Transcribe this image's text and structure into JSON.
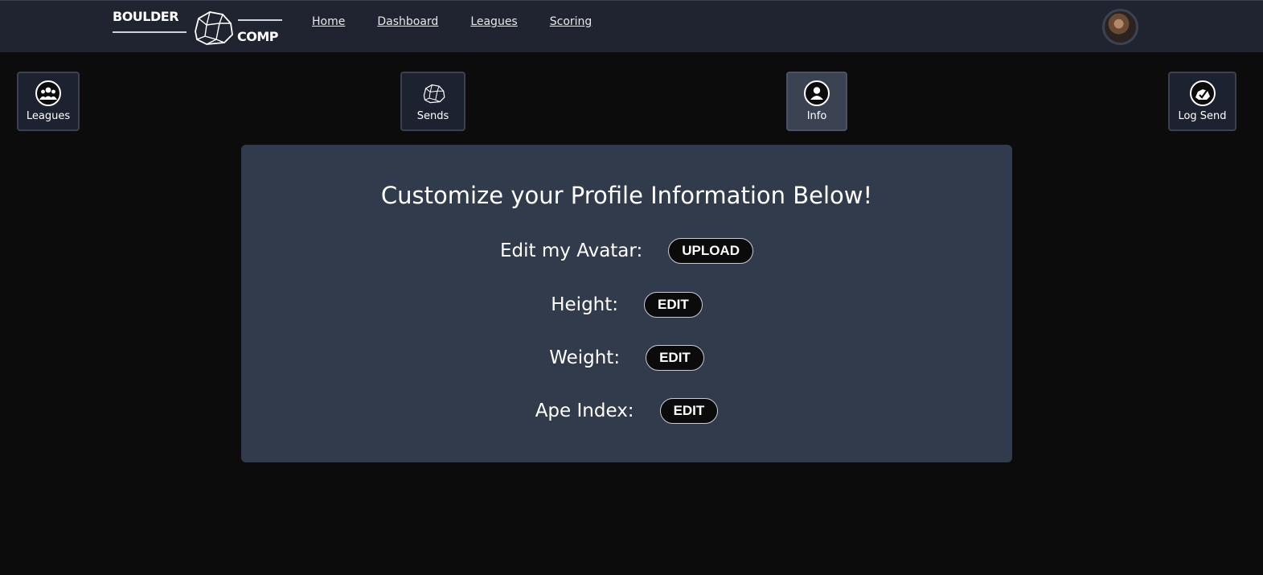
{
  "header": {
    "logo": {
      "top": "BOULDER",
      "bottom": "COMP"
    },
    "nav": [
      {
        "label": "Home"
      },
      {
        "label": "Dashboard"
      },
      {
        "label": "Leagues"
      },
      {
        "label": "Scoring"
      }
    ]
  },
  "tiles": {
    "leagues": {
      "label": "Leagues",
      "icon": "users-icon"
    },
    "sends": {
      "label": "Sends",
      "icon": "boulder-icon"
    },
    "info": {
      "label": "Info",
      "icon": "user-icon"
    },
    "log_send": {
      "label": "Log Send",
      "icon": "log-send-icon"
    }
  },
  "panel": {
    "title": "Customize your Profile Information Below!",
    "rows": [
      {
        "label": "Edit my Avatar:",
        "button": "UPLOAD"
      },
      {
        "label": "Height:",
        "button": "EDIT"
      },
      {
        "label": "Weight:",
        "button": "EDIT"
      },
      {
        "label": "Ape Index:",
        "button": "EDIT"
      }
    ]
  },
  "colors": {
    "page_bg": "#0c0c0c",
    "header_bg": "#1f2430",
    "panel_bg": "#323b4b",
    "tile_bg": "#1d2230",
    "tile_active_bg": "#3b4352",
    "button_bg": "#0b0b0c"
  }
}
